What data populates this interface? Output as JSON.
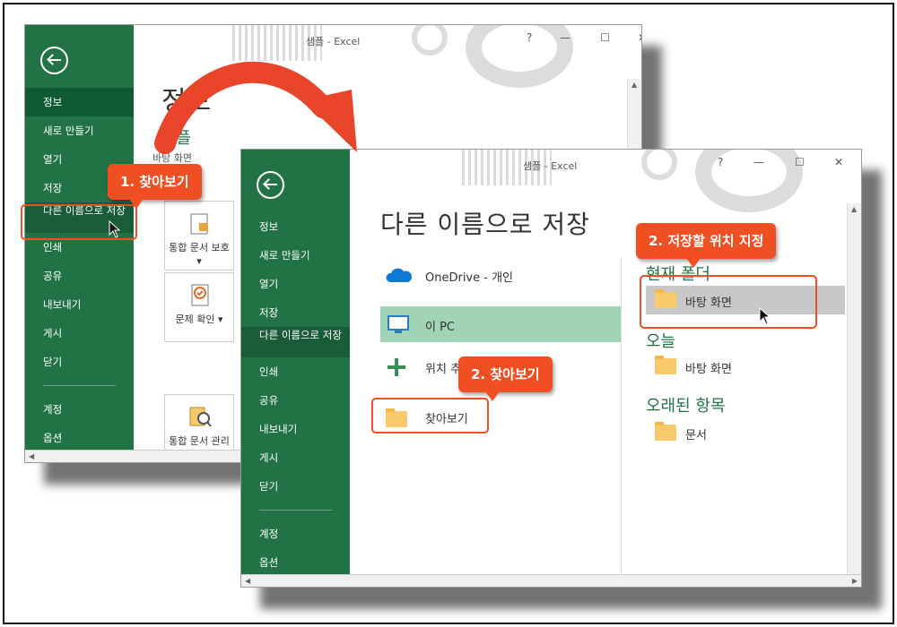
{
  "colors": {
    "excel_green": "#217346",
    "annotation": "#f04e23",
    "selected_location": "#a0d4b4"
  },
  "window_back": {
    "title": "샘플 - Excel",
    "controls": {
      "help": "?",
      "minimize": "—",
      "maximize": "☐",
      "close": "✕"
    },
    "menu": [
      "정보",
      "새로 만들기",
      "열기",
      "저장",
      "다른 이름으로 저장",
      "인쇄",
      "공유",
      "내보내기",
      "게시",
      "닫기",
      "계정",
      "옵션"
    ],
    "page_title": "정보",
    "sample_heading": "샘플",
    "path": "바탕 화면",
    "cards": [
      {
        "icon": "protect-workbook-icon",
        "label": "통합 문서 보호 ▾"
      },
      {
        "icon": "check-issues-icon",
        "label": "문제 확인 ▾"
      },
      {
        "icon": "manage-workbook-icon",
        "label": "통합 문서 관리 ▾"
      }
    ]
  },
  "window_front": {
    "title": "샘플 - Excel",
    "controls": {
      "help": "?",
      "minimize": "—",
      "maximize": "☐",
      "close": "✕"
    },
    "menu": [
      "정보",
      "새로 만들기",
      "열기",
      "저장",
      "다른 이름으로 저장",
      "인쇄",
      "공유",
      "내보내기",
      "게시",
      "닫기",
      "계정",
      "옵션"
    ],
    "page_title": "다른 이름으로 저장",
    "locations": [
      {
        "icon": "onedrive-icon",
        "label": "OneDrive - 개인"
      },
      {
        "icon": "pc-icon",
        "label": "이 PC"
      },
      {
        "icon": "add-location-icon",
        "label": "위치 추가"
      },
      {
        "icon": "folder-icon",
        "label": "찾아보기"
      }
    ],
    "sections": [
      {
        "heading": "현재 폴더",
        "items": [
          "바탕 화면"
        ]
      },
      {
        "heading": "오늘",
        "items": [
          "바탕 화면"
        ]
      },
      {
        "heading": "오래된 항목",
        "items": [
          "문서"
        ]
      }
    ]
  },
  "annotations": {
    "step1": "1. 찾아보기",
    "step2_folder": "2. 저장할 위치 지정",
    "step2_browse": "2. 찾아보기"
  }
}
